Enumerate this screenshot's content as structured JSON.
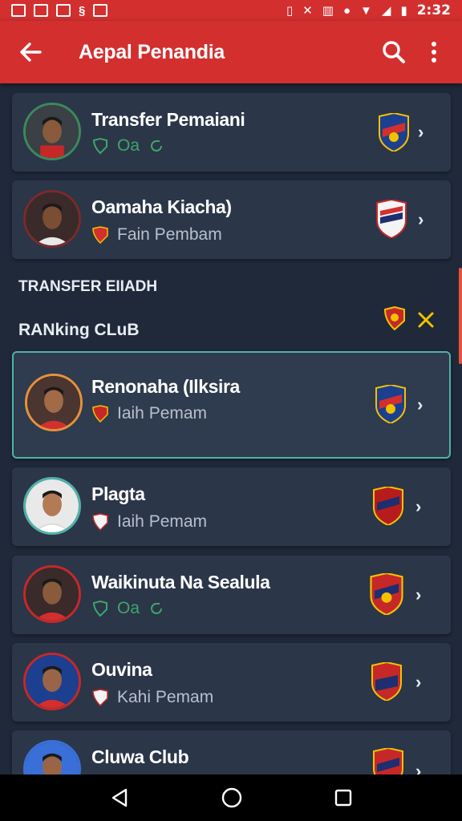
{
  "status_bar": {
    "time": "2:32"
  },
  "app_bar": {
    "title": "Aepal Penandia"
  },
  "cards": [
    {
      "name": "Transfer Pemaiani",
      "sub": "Oa",
      "sub_style": "green"
    },
    {
      "name": "Oamaha Kiacha)",
      "sub": "Fain Pembam",
      "sub_style": "grey"
    }
  ],
  "sections": {
    "transfer": "TRANSFER EIIADH",
    "ranking": "RANking CLuB"
  },
  "ranking_cards": [
    {
      "name": "Renonaha (Ilksira",
      "sub": "Iaih Pemam",
      "sub_style": "grey",
      "chevron": "›"
    },
    {
      "name": "Plagta",
      "sub": "Iaih Pemam",
      "sub_style": "grey",
      "chevron": "›"
    },
    {
      "name": "Waikinuta Na Sealula",
      "sub": "Oa",
      "sub_style": "green",
      "chevron": "›"
    },
    {
      "name": "Ouvina",
      "sub": "Kahi Pemam",
      "sub_style": "grey",
      "chevron": "›"
    },
    {
      "name": "Cluwa Club",
      "sub": "",
      "sub_style": "green",
      "chevron": "›"
    }
  ],
  "colors": {
    "accent": "#d32f2f",
    "background": "#1f293a",
    "card": "#2b3648",
    "selected_border": "#4fb3a5",
    "green": "#3fa56a"
  }
}
